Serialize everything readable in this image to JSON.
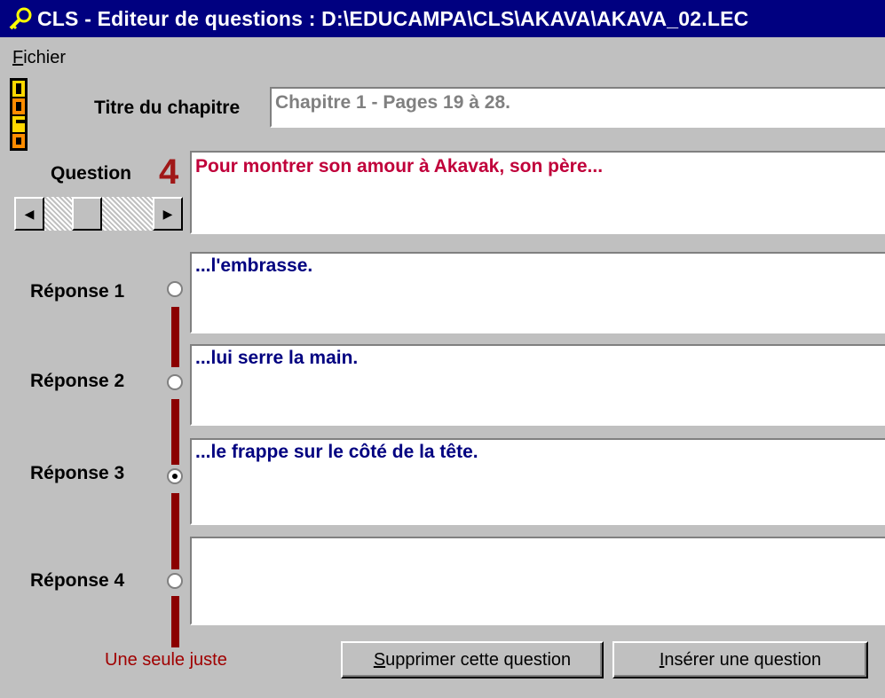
{
  "window": {
    "title": "CLS - Editeur de questions : D:\\EDUCAMPA\\CLS\\AKAVA\\AKAVA_02.LEC"
  },
  "menu": {
    "fichier_first": "F",
    "fichier_rest": "ichier"
  },
  "chapter": {
    "label": "Titre du chapitre",
    "value": "Chapitre 1 - Pages 19 à 28."
  },
  "question": {
    "label": "Question",
    "number": "4",
    "text": "Pour montrer son amour à Akavak, son père...",
    "scroll_position": 0.35
  },
  "answers": [
    {
      "label": "Réponse 1",
      "text": "...l'embrasse.",
      "checked": false
    },
    {
      "label": "Réponse 2",
      "text": "...lui serre la main.",
      "checked": false
    },
    {
      "label": "Réponse 3",
      "text": "...le frappe sur le côté de la tête.",
      "checked": true
    },
    {
      "label": "Réponse 4",
      "text": "",
      "checked": false
    }
  ],
  "hint": "Une seule juste",
  "buttons": {
    "delete_first": "S",
    "delete_rest": "upprimer cette question",
    "insert_first": "I",
    "insert_rest": "nsérer une question"
  },
  "colors": {
    "titlebar": "#000080",
    "question_text": "#c0003a",
    "answer_text": "#000080",
    "accent_bar": "#8b0000",
    "hint": "#a00000"
  },
  "icons": {
    "app": "key-search-icon",
    "logo": "educampa-logo"
  }
}
